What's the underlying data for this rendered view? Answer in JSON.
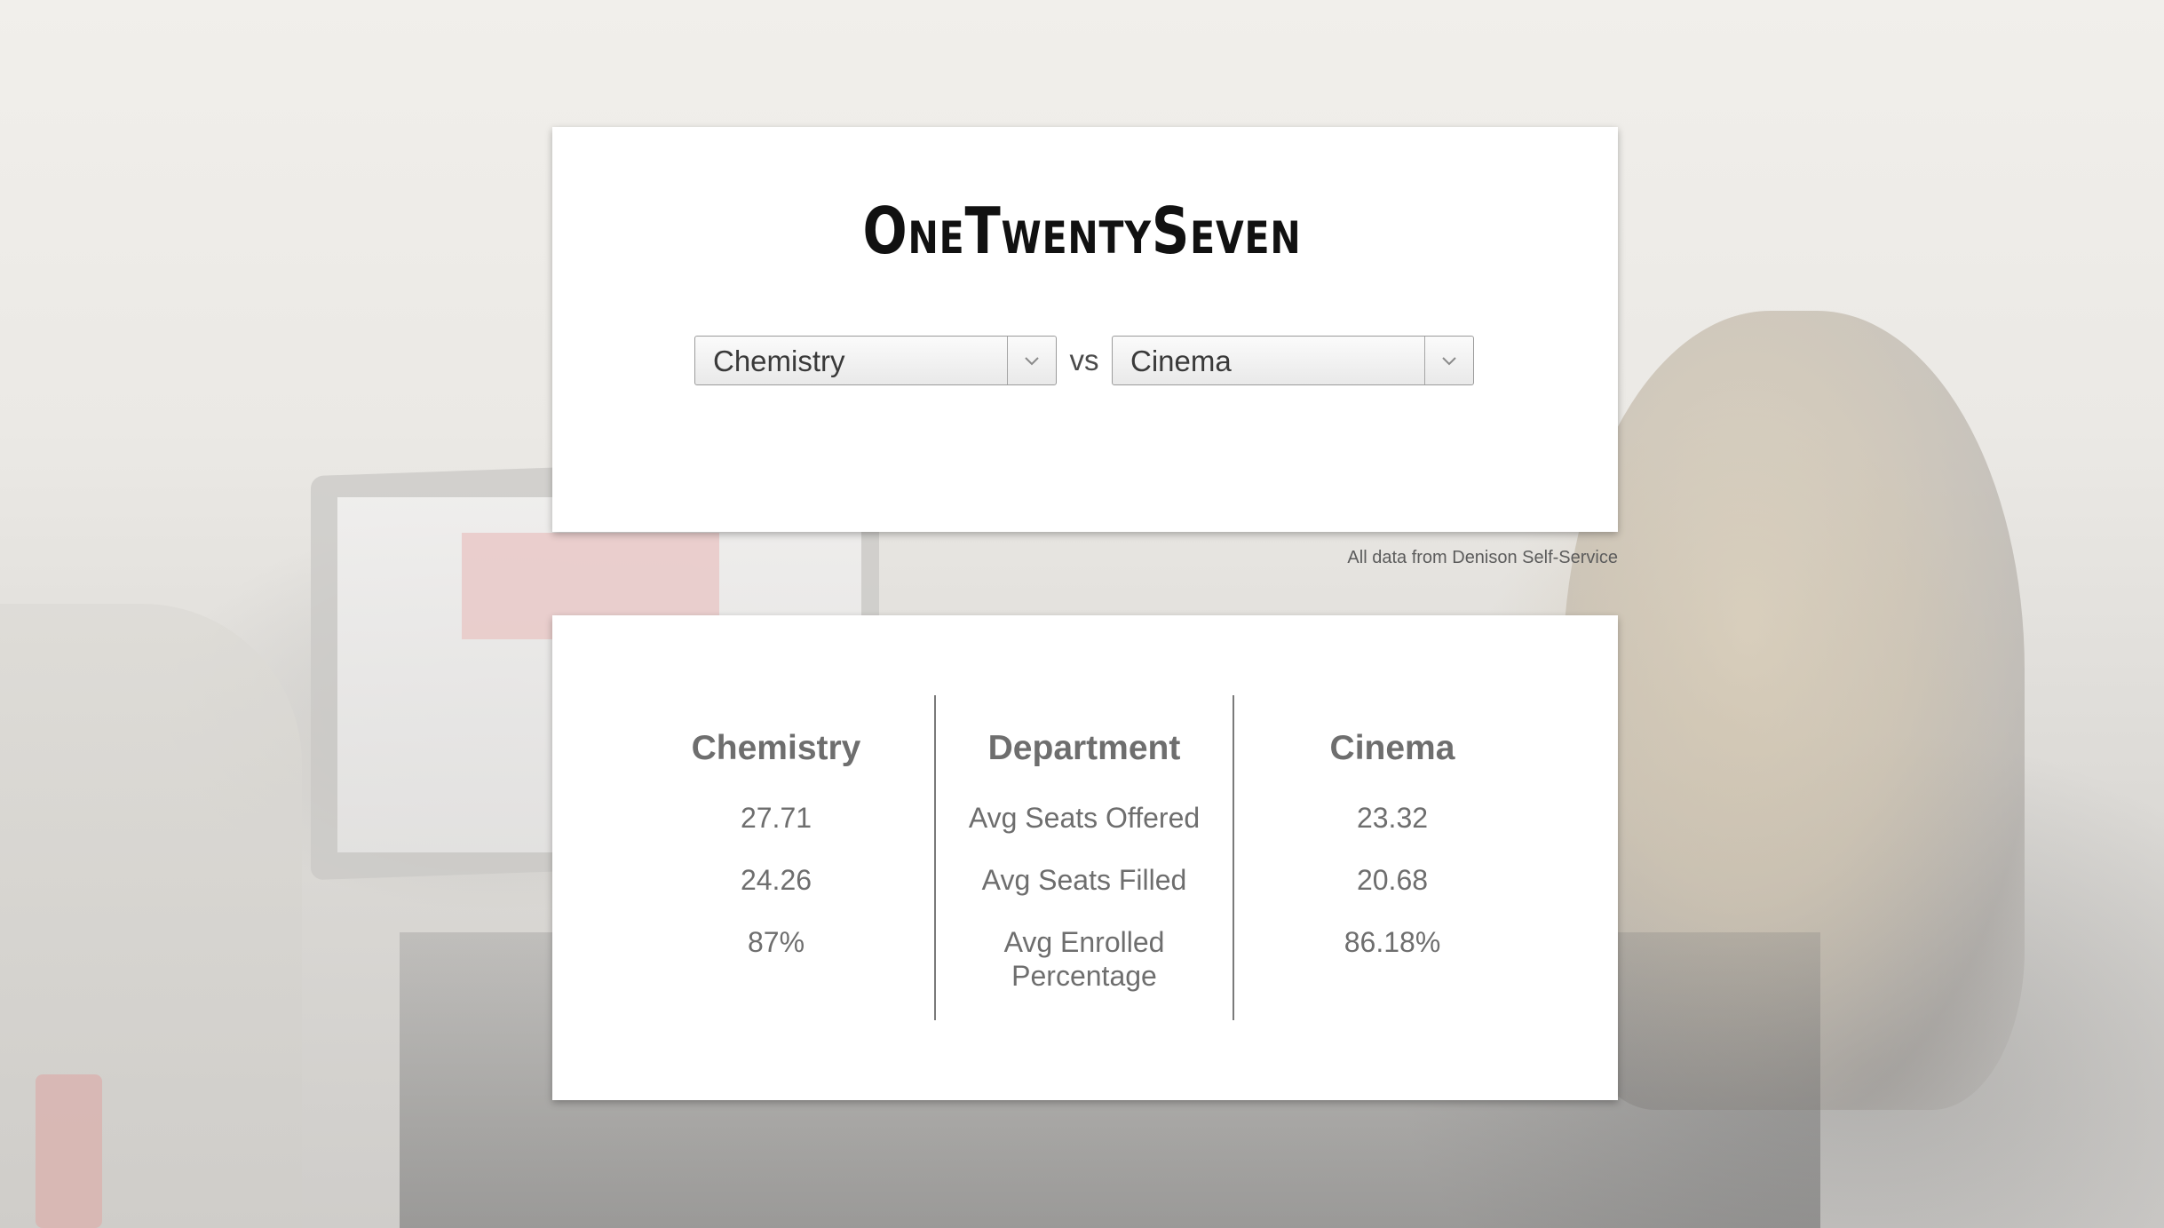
{
  "app": {
    "logo_text": "OneTwentySeven"
  },
  "comparison": {
    "left_department": "Chemistry",
    "separator": "vs",
    "right_department": "Cinema"
  },
  "source_note": "All data from Denison Self-Service",
  "stats_table": {
    "left_header": "Chemistry",
    "middle_header": "Department",
    "right_header": "Cinema",
    "rows": [
      {
        "left": "27.71",
        "label": "Avg Seats Offered",
        "right": "23.32"
      },
      {
        "left": "24.26",
        "label": "Avg Seats Filled",
        "right": "20.68"
      },
      {
        "left": "87%",
        "label": "Avg Enrolled Percentage",
        "right": "86.18%"
      }
    ]
  },
  "icons": {
    "dropdown_arrow": "chevron-down-icon"
  }
}
